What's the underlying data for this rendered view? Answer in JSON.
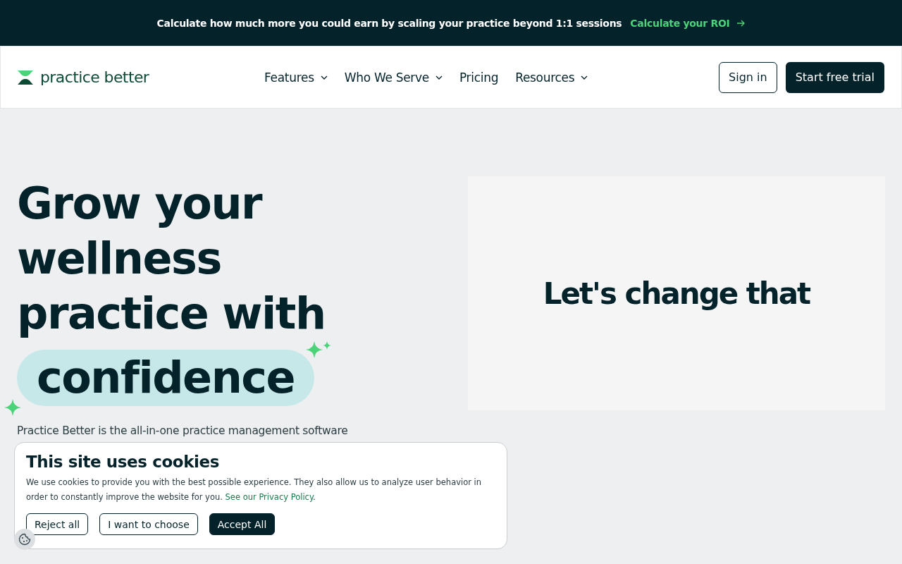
{
  "announcement": {
    "text": "Calculate how much more you could earn by scaling your practice beyond 1:1 sessions",
    "link": "Calculate your ROI"
  },
  "nav": {
    "logo": "practice better",
    "items": [
      {
        "label": "Features",
        "dropdown": true
      },
      {
        "label": "Who We Serve",
        "dropdown": true
      },
      {
        "label": "Pricing",
        "dropdown": false
      },
      {
        "label": "Resources",
        "dropdown": true
      }
    ],
    "sign_in": "Sign in",
    "cta": "Start free trial"
  },
  "hero": {
    "heading_lines": [
      "Grow your",
      "wellness",
      "practice with"
    ],
    "highlight": "confidence",
    "description": "Practice Better is the all-in-one practice management software"
  },
  "video_panel": {
    "text": "Let's change that"
  },
  "cookie_banner": {
    "title": "This site uses cookies",
    "text": "We use cookies to provide you with the best possible experience. They also allow us to analyze user behavior in order to constantly improve the website for you.",
    "link": "See our Privacy Policy",
    "link_suffix": ".",
    "buttons": [
      {
        "label": "Reject all",
        "kind": "outline"
      },
      {
        "label": "I want to choose",
        "kind": "outline"
      },
      {
        "label": "Accept All",
        "kind": "filled"
      }
    ]
  }
}
